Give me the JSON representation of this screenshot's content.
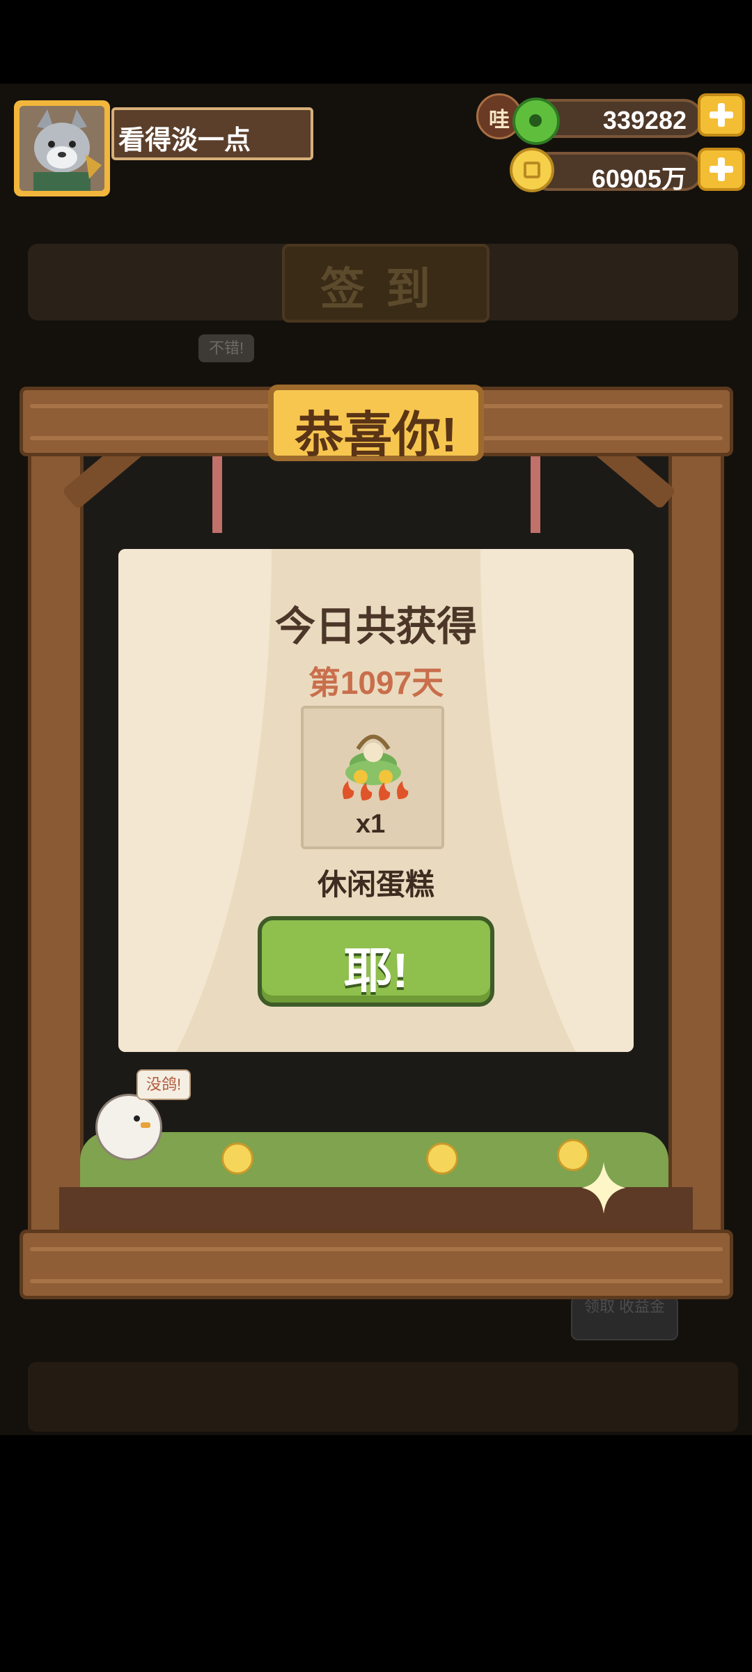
{
  "player": {
    "name": "看得淡一点"
  },
  "currencies": {
    "gem_badge": "哇",
    "gems": "339282",
    "coins": "60905万"
  },
  "background": {
    "title": "签到",
    "bubble": "不错!",
    "side_note": "领取 收益金"
  },
  "frame": {
    "title": "恭喜你!"
  },
  "reward_card": {
    "title": "今日共获得",
    "day": "第1097天",
    "item_quantity": "x1",
    "item_name": "休闲蛋糕",
    "confirm_label": "耶!"
  },
  "mascot": {
    "speech": "没鸽!"
  },
  "colors": {
    "accent_green": "#8fbf4d",
    "day_text": "#c96e4c",
    "wood": "#8a5a34",
    "gold": "#f4be34"
  },
  "icons": [
    "avatar-wolf-icon",
    "jade-gem-icon",
    "coin-icon",
    "plus-icon",
    "cake-item-icon",
    "sparkle-icon",
    "chick-icon"
  ]
}
